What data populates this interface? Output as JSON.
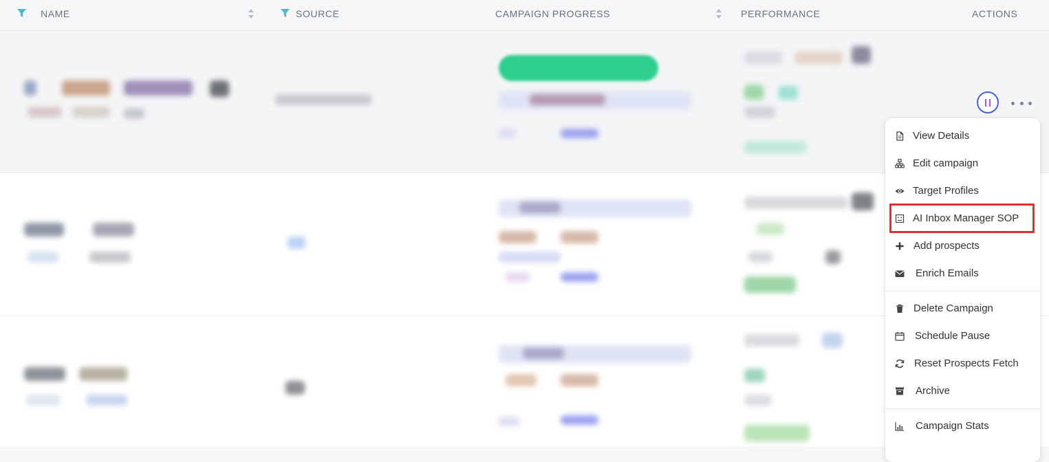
{
  "table": {
    "headers": {
      "name": "NAME",
      "source": "SOURCE",
      "campaign_progress": "CAMPAIGN PROGRESS",
      "performance": "PERFORMANCE",
      "actions": "ACTIONS"
    }
  },
  "actions_menu": {
    "items": [
      {
        "label": "View Details",
        "icon": "document-icon"
      },
      {
        "label": "Edit campaign",
        "icon": "sitemap-icon"
      },
      {
        "label": "Target Profiles",
        "icon": "eye-icon"
      },
      {
        "label": "AI Inbox Manager SOP",
        "icon": "robot-icon",
        "highlighted": true
      },
      {
        "label": "Add prospects",
        "icon": "plus-icon"
      },
      {
        "label": "Enrich Emails",
        "icon": "envelope-icon"
      },
      {
        "label": "Delete Campaign",
        "icon": "trash-icon"
      },
      {
        "label": "Schedule Pause",
        "icon": "calendar-icon"
      },
      {
        "label": "Reset Prospects Fetch",
        "icon": "refresh-icon"
      },
      {
        "label": "Archive",
        "icon": "archive-icon"
      },
      {
        "label": "Campaign Stats",
        "icon": "bar-chart-icon"
      }
    ]
  },
  "colors": {
    "highlight": "#d9342b",
    "pause_ring": "#4b5fd8",
    "filter_icon": "#56b6c9",
    "progress_bar": "#2ecf8e"
  }
}
